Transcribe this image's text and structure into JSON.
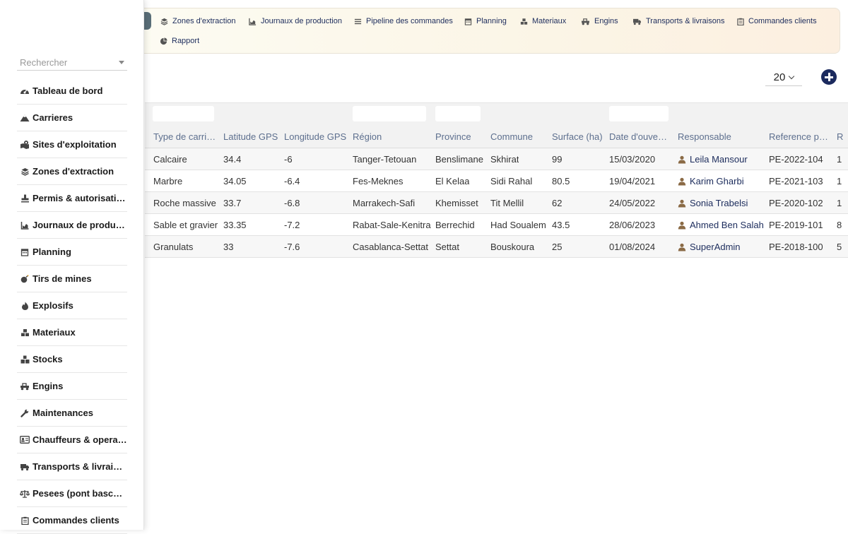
{
  "topnav": [
    {
      "label": "Zones d'extraction",
      "icon": "layers-icon"
    },
    {
      "label": "Journaux de production",
      "icon": "chart-icon"
    },
    {
      "label": "Pipeline des commandes",
      "icon": "bars-icon"
    },
    {
      "label": "Planning",
      "icon": "calendar-icon"
    },
    {
      "label": "Materiaux",
      "icon": "cubes-icon"
    },
    {
      "label": "Engins",
      "icon": "truck-loader-icon"
    },
    {
      "label": "Transports & livraisons",
      "icon": "truck-icon"
    },
    {
      "label": "Commandes clients",
      "icon": "clipboard-icon"
    },
    {
      "label": "Rapport",
      "icon": "pie-chart-icon"
    }
  ],
  "sidebar": {
    "search_placeholder": "Rechercher",
    "items": [
      {
        "label": "Tableau de bord",
        "icon": "dashboard-icon"
      },
      {
        "label": "Carrieres",
        "icon": "mountain-icon"
      },
      {
        "label": "Sites d'exploitation",
        "icon": "sites-icon"
      },
      {
        "label": "Zones d'extraction",
        "icon": "layers-icon"
      },
      {
        "label": "Permis & autorisations",
        "icon": "stamp-icon"
      },
      {
        "label": "Journaux de production",
        "icon": "chart-icon"
      },
      {
        "label": "Planning",
        "icon": "calendar-icon"
      },
      {
        "label": "Tirs de mines",
        "icon": "bomb-icon"
      },
      {
        "label": "Explosifs",
        "icon": "fire-icon"
      },
      {
        "label": "Materiaux",
        "icon": "cubes-icon"
      },
      {
        "label": "Stocks",
        "icon": "boxes-icon"
      },
      {
        "label": "Engins",
        "icon": "truck-loader-icon"
      },
      {
        "label": "Maintenances",
        "icon": "wrench-icon"
      },
      {
        "label": "Chauffeurs & operateurs",
        "icon": "id-card-icon"
      },
      {
        "label": "Transports & livraisons",
        "icon": "truck-icon"
      },
      {
        "label": "Pesees (pont bascule)",
        "icon": "scale-icon"
      },
      {
        "label": "Commandes clients",
        "icon": "clipboard-icon"
      }
    ]
  },
  "pagesize": "20",
  "table": {
    "columns": [
      "Type de carrière",
      "Latitude GPS",
      "Longitude GPS",
      "Région",
      "Province",
      "Commune",
      "Surface (ha)",
      "Date d'ouverture",
      "Responsable",
      "Reference permis",
      "R"
    ],
    "rows": [
      [
        "Calcaire",
        "34.4",
        "-6",
        "Tanger-Tetouan",
        "Benslimane",
        "Skhirat",
        "99",
        "15/03/2020",
        "Leila Mansour",
        "PE-2022-104",
        "1"
      ],
      [
        "Marbre",
        "34.05",
        "-6.4",
        "Fes-Meknes",
        "El Kelaa",
        "Sidi Rahal",
        "80.5",
        "19/04/2021",
        "Karim Gharbi",
        "PE-2021-103",
        "1"
      ],
      [
        "Roche massive",
        "33.7",
        "-6.8",
        "Marrakech-Safi",
        "Khemisset",
        "Tit Mellil",
        "62",
        "24/05/2022",
        "Sonia Trabelsi",
        "PE-2020-102",
        "1"
      ],
      [
        "Sable et gravier",
        "33.35",
        "-7.2",
        "Rabat-Sale-Kenitra",
        "Berrechid",
        "Had Soualem",
        "43.5",
        "28/06/2023",
        "Ahmed Ben Salah",
        "PE-2019-101",
        "8"
      ],
      [
        "Granulats",
        "33",
        "-7.6",
        "Casablanca-Settat",
        "Settat",
        "Bouskoura",
        "25",
        "01/08/2024",
        "SuperAdmin",
        "PE-2018-100",
        "5"
      ]
    ]
  },
  "colors": {
    "accent": "#1b2a5e",
    "header_text": "#5d6f8e",
    "link": "#1c2c5c",
    "user_icon": "#8a6a45"
  }
}
